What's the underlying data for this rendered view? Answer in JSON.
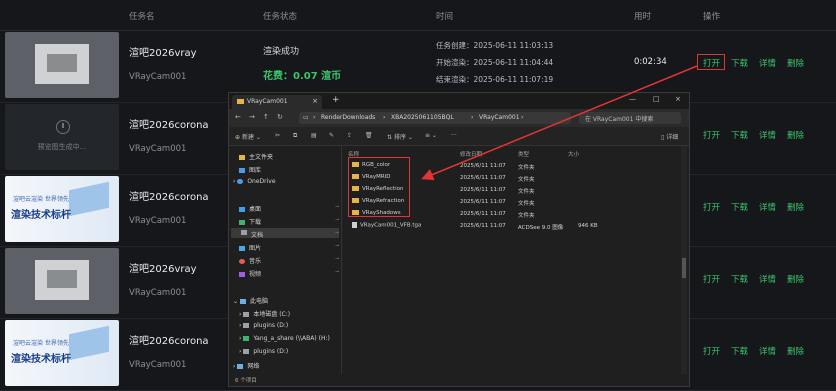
{
  "header": {
    "col_task_name": "任务名",
    "col_task_status": "任务状态",
    "col_time": "时间",
    "col_duration": "用时",
    "col_action": "操作"
  },
  "rows": [
    {
      "name": "渲吧2026vray",
      "camera": "VRayCam001",
      "status": "渲染成功",
      "cost": "花费：0.07 渲币",
      "created": "任务创建：2025-06-11 11:03:13",
      "started": "开始渲染：2025-06-11 11:04:44",
      "ended": "结束渲染：2025-06-11 11:07:19",
      "duration": "0:02:34",
      "thumb": "room"
    },
    {
      "name": "渲吧2026corona",
      "camera": "VRayCam001",
      "thumb": "dark",
      "preview_text": "预览图生成中..."
    },
    {
      "name": "渲吧2026corona",
      "camera": "VRayCam001",
      "thumb": "banner",
      "banner_title": "渲染技术标杆",
      "banner_sub": "渲吧云渲染 世界领先"
    },
    {
      "name": "渲吧2026vray",
      "camera": "VRayCam001",
      "thumb": "room"
    },
    {
      "name": "渲吧2026corona",
      "camera": "VRayCam001",
      "thumb": "banner",
      "banner_title": "渲染技术标杆",
      "banner_sub": "渲吧云渲染 世界领先"
    }
  ],
  "actions": {
    "open": "打开",
    "download": "下载",
    "details": "详情",
    "delete": "删除"
  },
  "explorer": {
    "tab_title": "VRayCam001",
    "path": [
      "RenderDownloads",
      "XBA2025061105BQL",
      "VRayCam001"
    ],
    "search_placeholder": "在 VRayCam001 中搜索",
    "new_button": "新建",
    "sort_button": "排序",
    "view_button": "查看",
    "details_button": "详细",
    "sidebar": {
      "home": "主文件夹",
      "gallery": "图库",
      "onedrive": "OneDrive",
      "desktop": "桌面",
      "downloads": "下载",
      "documents": "文档",
      "pictures": "图片",
      "music": "音乐",
      "videos": "视频",
      "this_pc": "此电脑",
      "local_disk": "本地磁盘 (C:)",
      "plugins_d": "plugins (D:)",
      "share": "Yang_a_share (\\\\ABA) (H:)",
      "plugins_d2": "plugins (D:)",
      "network": "网络"
    },
    "columns": {
      "name": "名称",
      "modified": "修改日期",
      "type": "类型",
      "size": "大小"
    },
    "files": [
      {
        "name": "RGB_color",
        "date": "2025/6/11 11:07",
        "type": "文件夹",
        "size": "",
        "kind": "folder"
      },
      {
        "name": "VRayMRID",
        "date": "2025/6/11 11:07",
        "type": "文件夹",
        "size": "",
        "kind": "folder"
      },
      {
        "name": "VRayReflection",
        "date": "2025/6/11 11:07",
        "type": "文件夹",
        "size": "",
        "kind": "folder"
      },
      {
        "name": "VRayRefraction",
        "date": "2025/6/11 11:07",
        "type": "文件夹",
        "size": "",
        "kind": "folder"
      },
      {
        "name": "VRayShadows",
        "date": "2025/6/11 11:07",
        "type": "文件夹",
        "size": "",
        "kind": "folder"
      },
      {
        "name": "VRayCam001_VFB.tga",
        "date": "2025/6/11 11:07",
        "type": "ACDSee 9.0 图像",
        "size": "946 KB",
        "kind": "file"
      }
    ],
    "status": "6 个项目"
  },
  "colors": {
    "accent_green": "#3bc46a",
    "highlight_red": "#e03535",
    "folder_yellow": "#e8b24a"
  }
}
